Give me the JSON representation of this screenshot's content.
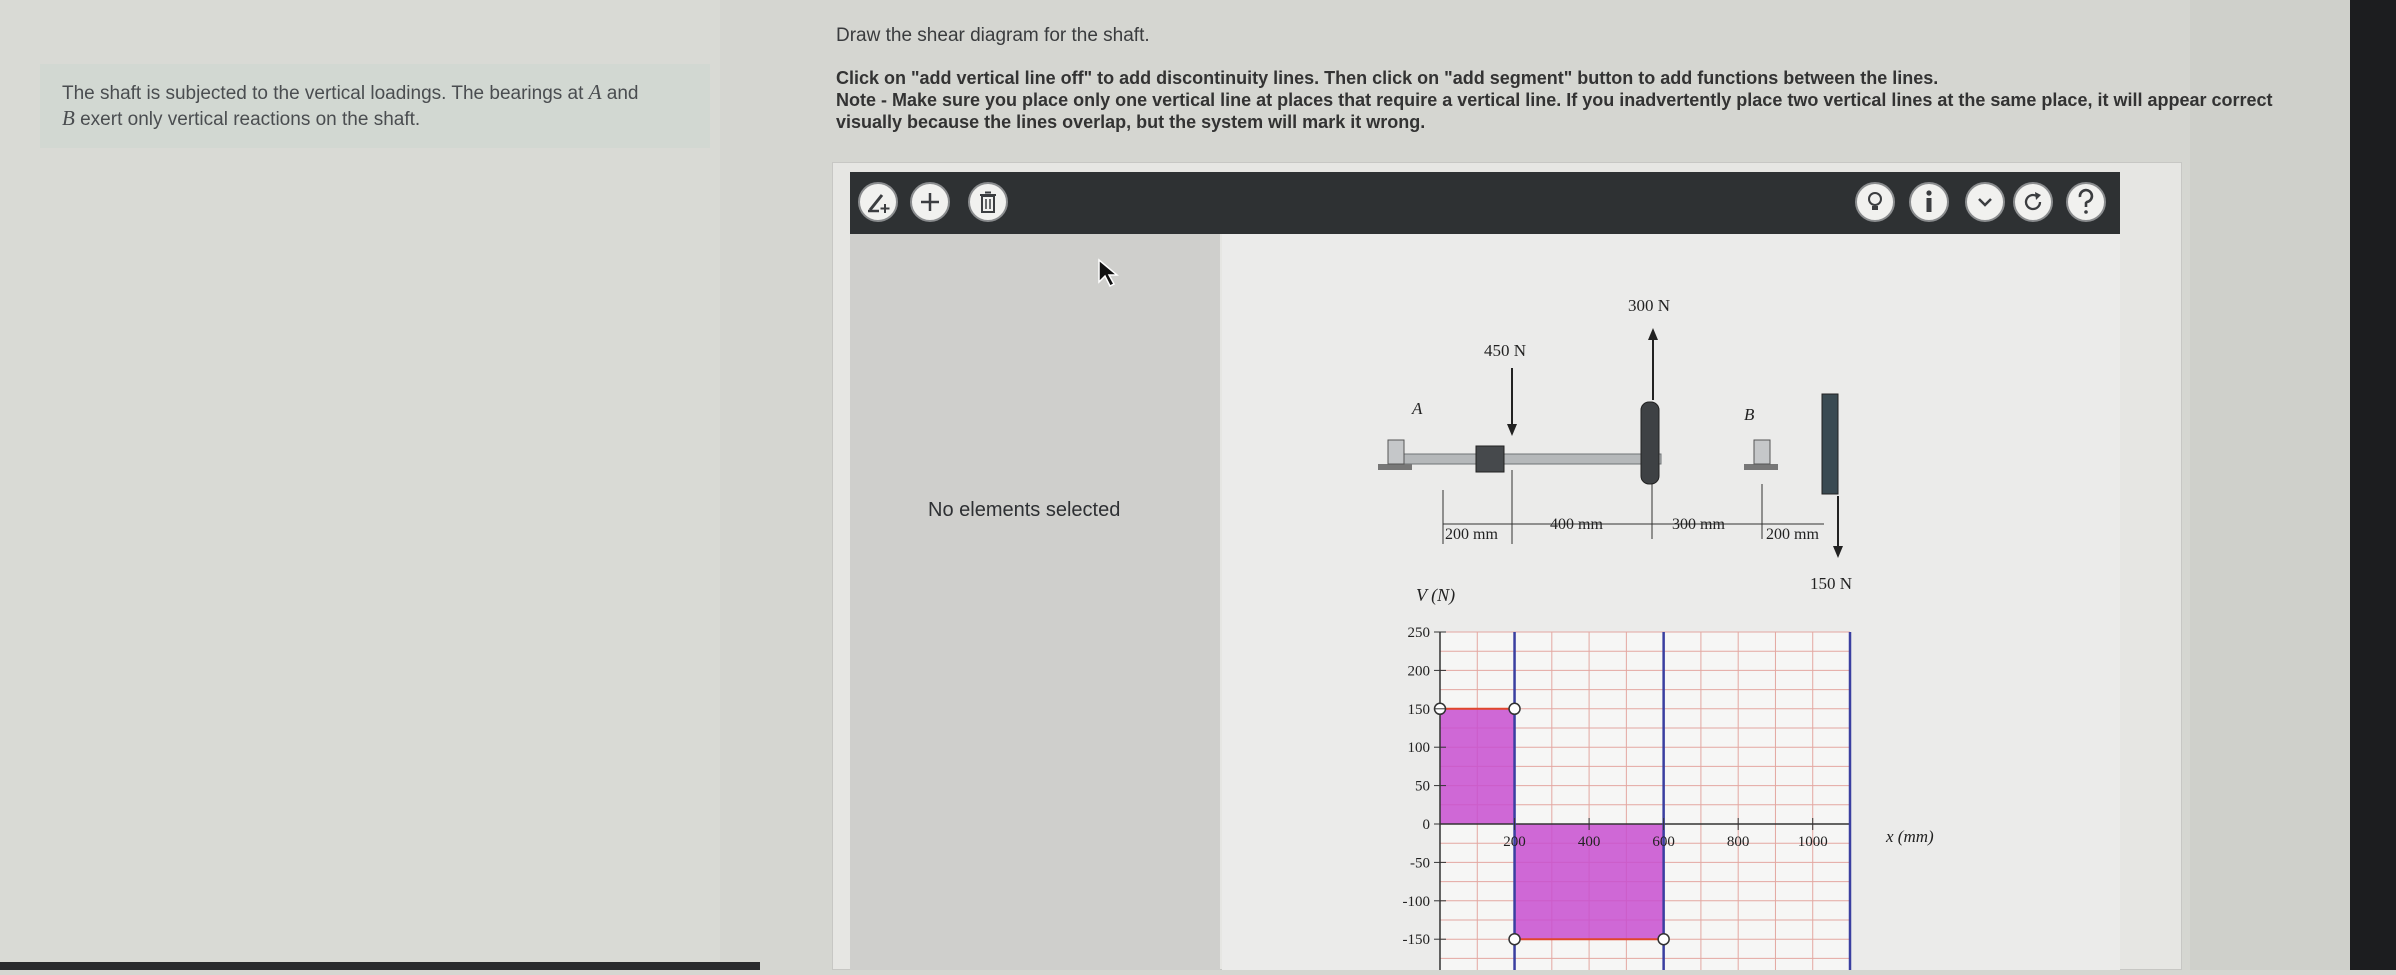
{
  "problem": {
    "text_before_A": "The shaft is subjected to the vertical loadings. The bearings at",
    "var_a": "A",
    "text_and": "and",
    "var_b": "B",
    "text_after_B": "exert only vertical reactions on the shaft."
  },
  "instructions": {
    "title": "Draw the shear diagram for the shaft.",
    "line1": "Click on \"add vertical line off\" to add discontinuity lines. Then click on \"add segment\" button to add functions between the lines.",
    "line2": "Note - Make sure you place only one vertical line at places that require a vertical line. If you inadvertently place two vertical lines at the same place, it will appear correct visually because the lines overlap, but the system will mark it wrong."
  },
  "toolbar": {
    "left_icons": [
      "add-vertical-line-icon",
      "add-segment-icon",
      "trash-icon"
    ],
    "right_icons": [
      "hint-bulb-icon",
      "info-icon",
      "chevron-down-icon",
      "refresh-icon",
      "help-icon"
    ]
  },
  "panel": {
    "status": "No elements selected"
  },
  "figure": {
    "label_A": "A",
    "label_B": "B",
    "load_450": "450 N",
    "load_300": "300 N",
    "load_150": "150 N",
    "dim_200_left": "200 mm",
    "dim_400": "400 mm",
    "dim_300": "300 mm",
    "dim_200_right": "200 mm"
  },
  "chart_data": {
    "type": "area",
    "ylabel": "V (N)",
    "xlabel": "x (mm)",
    "yticks": [
      250,
      200,
      150,
      100,
      50,
      0,
      -50,
      -100,
      -150
    ],
    "ytick_labels": [
      "250",
      "200",
      "150",
      "100",
      "50",
      "0",
      "-50",
      "-100",
      "-150"
    ],
    "xticks": [
      200,
      400,
      600,
      800,
      1000
    ],
    "xtick_labels": [
      "200",
      "400",
      "600",
      "800",
      "1000"
    ],
    "xlim": [
      0,
      1100
    ],
    "ylim": [
      -150,
      250
    ],
    "vertical_lines": [
      200,
      600,
      1100
    ],
    "segments": [
      {
        "x_start": 0,
        "x_end": 200,
        "value": 150
      },
      {
        "x_start": 200,
        "x_end": 600,
        "value": -150
      }
    ],
    "colors": {
      "fill": "#c84fd0",
      "line": "#e0462b",
      "vertical": "#3a3fa0",
      "grid": "#e3a7a1"
    }
  }
}
